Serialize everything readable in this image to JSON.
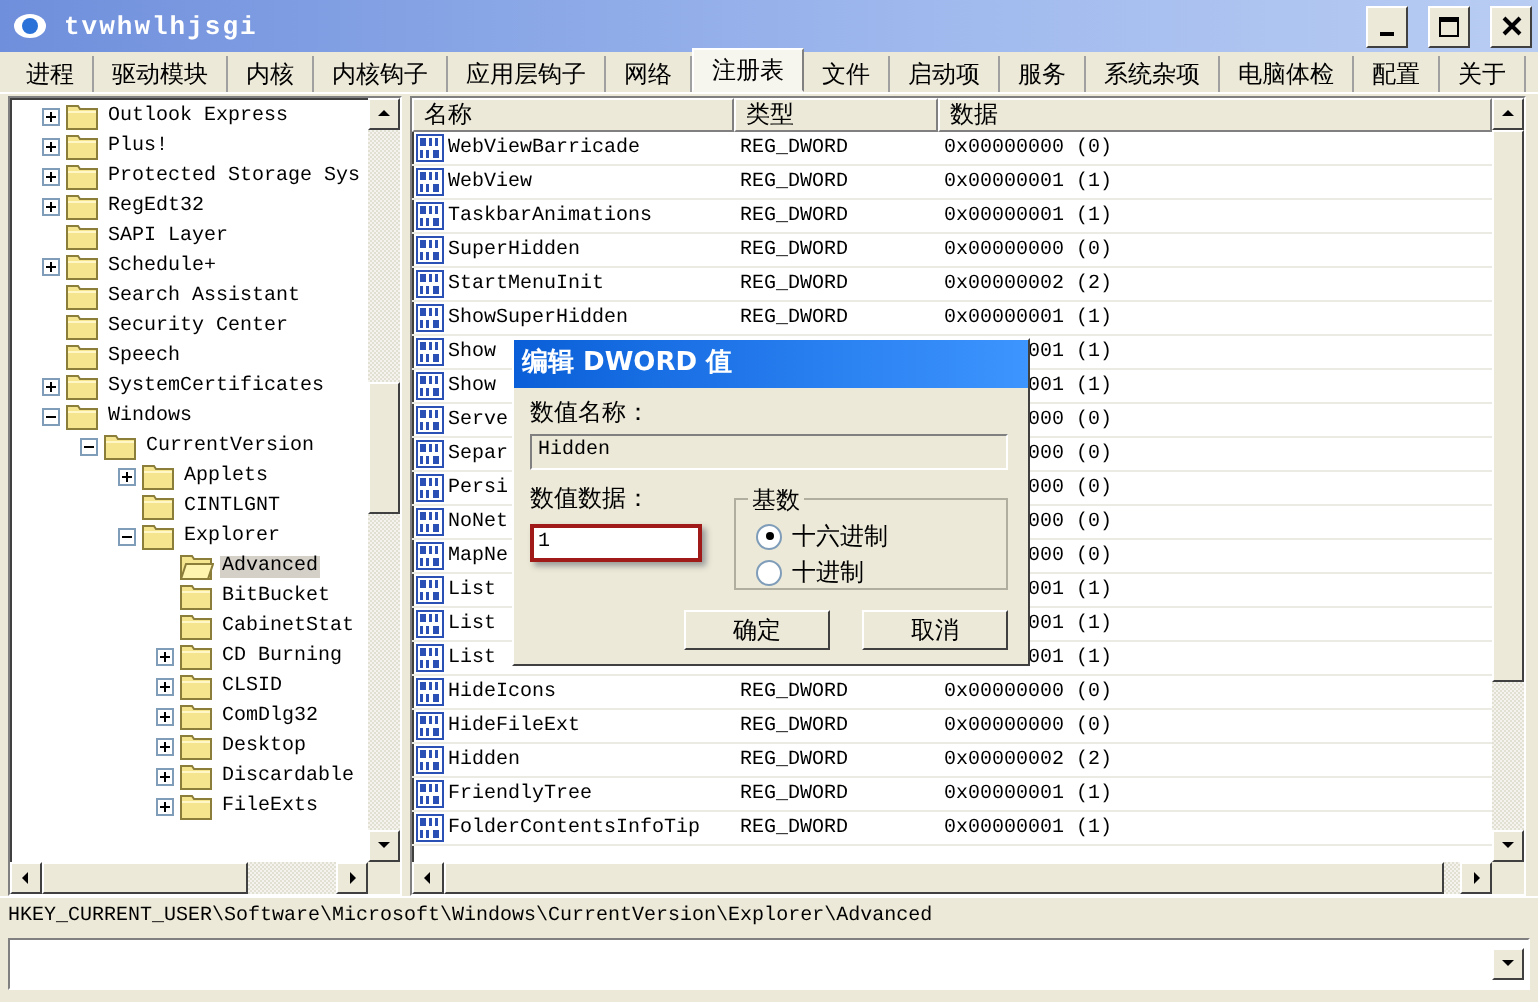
{
  "window": {
    "title": "tvwhwlhjsgi"
  },
  "tabs": [
    {
      "label": "进程",
      "selected": false
    },
    {
      "label": "驱动模块",
      "selected": false
    },
    {
      "label": "内核",
      "selected": false
    },
    {
      "label": "内核钩子",
      "selected": false
    },
    {
      "label": "应用层钩子",
      "selected": false
    },
    {
      "label": "网络",
      "selected": false
    },
    {
      "label": "注册表",
      "selected": true
    },
    {
      "label": "文件",
      "selected": false
    },
    {
      "label": "启动项",
      "selected": false
    },
    {
      "label": "服务",
      "selected": false
    },
    {
      "label": "系统杂项",
      "selected": false
    },
    {
      "label": "电脑体检",
      "selected": false
    },
    {
      "label": "配置",
      "selected": false
    },
    {
      "label": "关于",
      "selected": false
    }
  ],
  "tree": {
    "items": [
      {
        "label": "Outlook Express",
        "kind": "collapsed",
        "selected": false
      },
      {
        "label": "Plus!",
        "kind": "collapsed",
        "selected": false
      },
      {
        "label": "Protected Storage Sys",
        "kind": "collapsed",
        "selected": false
      },
      {
        "label": "RegEdt32",
        "kind": "collapsed",
        "selected": false
      },
      {
        "label": "SAPI Layer",
        "kind": "leaf",
        "selected": false
      },
      {
        "label": "Schedule+",
        "kind": "collapsed",
        "selected": false
      },
      {
        "label": "Search Assistant",
        "kind": "leaf",
        "selected": false
      },
      {
        "label": "Security Center",
        "kind": "leaf",
        "selected": false
      },
      {
        "label": "Speech",
        "kind": "leaf",
        "selected": false
      },
      {
        "label": "SystemCertificates",
        "kind": "collapsed",
        "selected": false
      },
      {
        "label": "Windows",
        "kind": "expanded",
        "selected": false,
        "children": [
          {
            "label": "CurrentVersion",
            "kind": "expanded",
            "selected": false,
            "children": [
              {
                "label": "Applets",
                "kind": "collapsed",
                "selected": false
              },
              {
                "label": "CINTLGNT",
                "kind": "leaf",
                "selected": false
              },
              {
                "label": "Explorer",
                "kind": "expanded",
                "selected": false,
                "children": [
                  {
                    "label": "Advanced",
                    "kind": "leaf",
                    "selected": true
                  },
                  {
                    "label": "BitBucket",
                    "kind": "leaf",
                    "selected": false
                  },
                  {
                    "label": "CabinetStat",
                    "kind": "leaf",
                    "selected": false
                  },
                  {
                    "label": "CD Burning",
                    "kind": "collapsed",
                    "selected": false
                  },
                  {
                    "label": "CLSID",
                    "kind": "collapsed",
                    "selected": false
                  },
                  {
                    "label": "ComDlg32",
                    "kind": "collapsed",
                    "selected": false
                  },
                  {
                    "label": "Desktop",
                    "kind": "collapsed",
                    "selected": false
                  },
                  {
                    "label": "Discardable",
                    "kind": "collapsed",
                    "selected": false
                  },
                  {
                    "label": "FileExts",
                    "kind": "collapsed",
                    "selected": false
                  }
                ]
              }
            ]
          }
        ]
      }
    ]
  },
  "list": {
    "columns": [
      "名称",
      "类型",
      "数据"
    ],
    "rows": [
      {
        "kind": "full",
        "name": "WebViewBarricade",
        "type": "REG_DWORD",
        "data": "0x00000000 (0)"
      },
      {
        "kind": "full",
        "name": "WebView",
        "type": "REG_DWORD",
        "data": "0x00000001 (1)"
      },
      {
        "kind": "full",
        "name": "TaskbarAnimations",
        "type": "REG_DWORD",
        "data": "0x00000001 (1)"
      },
      {
        "kind": "full",
        "name": "SuperHidden",
        "type": "REG_DWORD",
        "data": "0x00000000 (0)"
      },
      {
        "kind": "full",
        "name": "StartMenuInit",
        "type": "REG_DWORD",
        "data": "0x00000002 (2)"
      },
      {
        "kind": "full",
        "name": "ShowSuperHidden",
        "type": "REG_DWORD",
        "data": "0x00000001 (1)"
      },
      {
        "kind": "covered",
        "name": "Show",
        "data": "001 (1)"
      },
      {
        "kind": "covered",
        "name": "Show",
        "data": "001 (1)"
      },
      {
        "kind": "covered",
        "name": "Serve",
        "data": "000 (0)"
      },
      {
        "kind": "covered",
        "name": "Separ",
        "data": "000 (0)"
      },
      {
        "kind": "covered",
        "name": "Persi",
        "data": "000 (0)"
      },
      {
        "kind": "covered",
        "name": "NoNet",
        "data": "000 (0)"
      },
      {
        "kind": "covered",
        "name": "MapNe",
        "data": "000 (0)"
      },
      {
        "kind": "covered",
        "name": "List",
        "data": "001 (1)"
      },
      {
        "kind": "covered",
        "name": "List",
        "data": "001 (1)"
      },
      {
        "kind": "covered",
        "name": "List",
        "data": "001 (1)"
      },
      {
        "kind": "full",
        "name": "HideIcons",
        "type": "REG_DWORD",
        "data": "0x00000000 (0)"
      },
      {
        "kind": "full",
        "name": "HideFileExt",
        "type": "REG_DWORD",
        "data": "0x00000000 (0)"
      },
      {
        "kind": "full",
        "name": "Hidden",
        "type": "REG_DWORD",
        "data": "0x00000002 (2)"
      },
      {
        "kind": "full",
        "name": "FriendlyTree",
        "type": "REG_DWORD",
        "data": "0x00000001 (1)"
      },
      {
        "kind": "full",
        "name": "FolderContentsInfoTip",
        "type": "REG_DWORD",
        "data": "0x00000001 (1)"
      }
    ]
  },
  "dialog": {
    "title": "编辑 DWORD 值",
    "name_label": "数值名称：",
    "name_value": "Hidden",
    "data_label": "数值数据：",
    "data_value": "1",
    "base_label": "基数",
    "bases": [
      {
        "label": "十六进制",
        "selected": true
      },
      {
        "label": "十进制",
        "selected": false
      }
    ],
    "buttons": [
      "确定",
      "取消"
    ]
  },
  "status_bar": {
    "path": "HKEY_CURRENT_USER\\Software\\Microsoft\\Windows\\CurrentVersion\\Explorer\\Advanced"
  }
}
